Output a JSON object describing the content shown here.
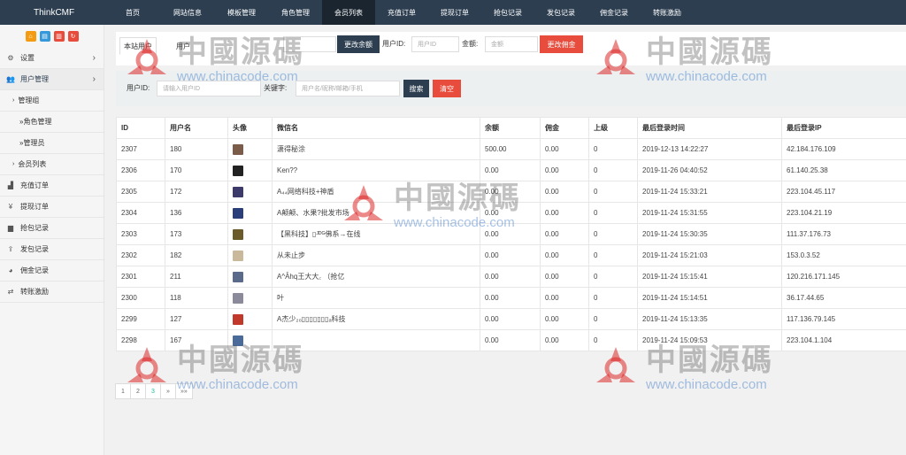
{
  "app": {
    "brand": "ThinkCMF"
  },
  "nav": [
    {
      "label": "首页"
    },
    {
      "label": "网站信息"
    },
    {
      "label": "模板管理"
    },
    {
      "label": "角色管理"
    },
    {
      "label": "会员列表"
    },
    {
      "label": "充值订单"
    },
    {
      "label": "提现订单"
    },
    {
      "label": "抢包记录"
    },
    {
      "label": "发包记录"
    },
    {
      "label": "佣金记录"
    },
    {
      "label": "转账激励"
    }
  ],
  "sidebar": {
    "tool_colors": [
      "#f39c12",
      "#3498db",
      "#e74c3c",
      "#e74c3c"
    ],
    "items": [
      {
        "label": "设置",
        "icon": "gears-icon"
      },
      {
        "label": "用户管理",
        "icon": "users-icon"
      },
      {
        "label": "管理组"
      },
      {
        "label": "»角色管理"
      },
      {
        "label": "»管理员"
      },
      {
        "label": "会员列表"
      },
      {
        "label": "充值订单",
        "icon": "chart-area-icon"
      },
      {
        "label": "提现订单",
        "icon": "yen-icon"
      },
      {
        "label": "抢包记录",
        "icon": "bar-chart-icon"
      },
      {
        "label": "发包记录",
        "icon": "upload-icon"
      },
      {
        "label": "佣金记录",
        "icon": "pie-chart-icon"
      },
      {
        "label": "转账激励",
        "icon": "transfer-icon"
      }
    ]
  },
  "form1": {
    "tab_active": "本站用户",
    "tab_other": "用户",
    "balance_btn": "更改余额",
    "userid_label": "用户ID:",
    "userid_placeholder": "用户ID",
    "amount_label": "金额:",
    "amount_placeholder": "金额",
    "commission_btn": "更改佣金"
  },
  "form2": {
    "userid_label": "用户ID:",
    "userid_placeholder": "请输入用户ID",
    "keyword_label": "关键字:",
    "keyword_placeholder": "用户名/昵称/邮箱/手机",
    "search_btn": "搜索",
    "clear_btn": "清空"
  },
  "table": {
    "headers": [
      "ID",
      "用户名",
      "头像",
      "微信名",
      "余额",
      "佣金",
      "上级",
      "最后登录时间",
      "最后登录IP"
    ],
    "rows": [
      {
        "id": "2307",
        "name": "180",
        "avatar_color": "#7a5c48",
        "wx": "潇得秘涂",
        "balance": "500.00",
        "comm": "0.00",
        "parent": "0",
        "time": "2019-12-13 14:22:27",
        "ip": "42.184.176.109"
      },
      {
        "id": "2306",
        "name": "170",
        "avatar_color": "#222222",
        "wx": "Ken??",
        "balance": "0.00",
        "comm": "0.00",
        "parent": "0",
        "time": "2019-11-26 04:40:52",
        "ip": "61.140.25.38"
      },
      {
        "id": "2305",
        "name": "172",
        "avatar_color": "#3b3a6a",
        "wx": "A₄₄网络科技+神盾",
        "balance": "0.00",
        "comm": "0.00",
        "parent": "0",
        "time": "2019-11-24 15:33:21",
        "ip": "223.104.45.117"
      },
      {
        "id": "2304",
        "name": "136",
        "avatar_color": "#2a3f7a",
        "wx": "A颠颠、水果?批发市场",
        "balance": "0.00",
        "comm": "0.00",
        "parent": "0",
        "time": "2019-11-24 15:31:55",
        "ip": "223.104.21.19"
      },
      {
        "id": "2303",
        "name": "173",
        "avatar_color": "#6b5a2a",
        "wx": "【黑科技】▯ᴶᴰᴳ佛系→在线",
        "balance": "0.00",
        "comm": "0.00",
        "parent": "0",
        "time": "2019-11-24 15:30:35",
        "ip": "111.37.176.73"
      },
      {
        "id": "2302",
        "name": "182",
        "avatar_color": "#c9b99a",
        "wx": "从未止步",
        "balance": "0.00",
        "comm": "0.00",
        "parent": "0",
        "time": "2019-11-24 15:21:03",
        "ip": "153.0.3.52"
      },
      {
        "id": "2301",
        "name": "211",
        "avatar_color": "#5a6a8a",
        "wx": "A^Ǡhq王大大꜀ （抢亿",
        "balance": "0.00",
        "comm": "0.00",
        "parent": "0",
        "time": "2019-11-24 15:15:41",
        "ip": "120.216.171.145"
      },
      {
        "id": "2300",
        "name": "118",
        "avatar_color": "#8a8a9a",
        "wx": "叶",
        "balance": "0.00",
        "comm": "0.00",
        "parent": "0",
        "time": "2019-11-24 15:14:51",
        "ip": "36.17.44.65"
      },
      {
        "id": "2299",
        "name": "127",
        "avatar_color": "#c0392b",
        "wx": "A杰少₂₀▯▯▯▯▯▯▯ₐ科技",
        "balance": "0.00",
        "comm": "0.00",
        "parent": "0",
        "time": "2019-11-24 15:13:35",
        "ip": "117.136.79.145"
      },
      {
        "id": "2298",
        "name": "167",
        "avatar_color": "#4a6a9a",
        "wx": "",
        "balance": "0.00",
        "comm": "0.00",
        "parent": "0",
        "time": "2019-11-24 15:09:53",
        "ip": "223.104.1.104"
      }
    ]
  },
  "pagination": [
    "1",
    "2",
    "3",
    "»",
    "»»"
  ],
  "pagination_current": "3",
  "watermark": {
    "cn": "中國源碼",
    "url": "www.chinacode.com"
  }
}
